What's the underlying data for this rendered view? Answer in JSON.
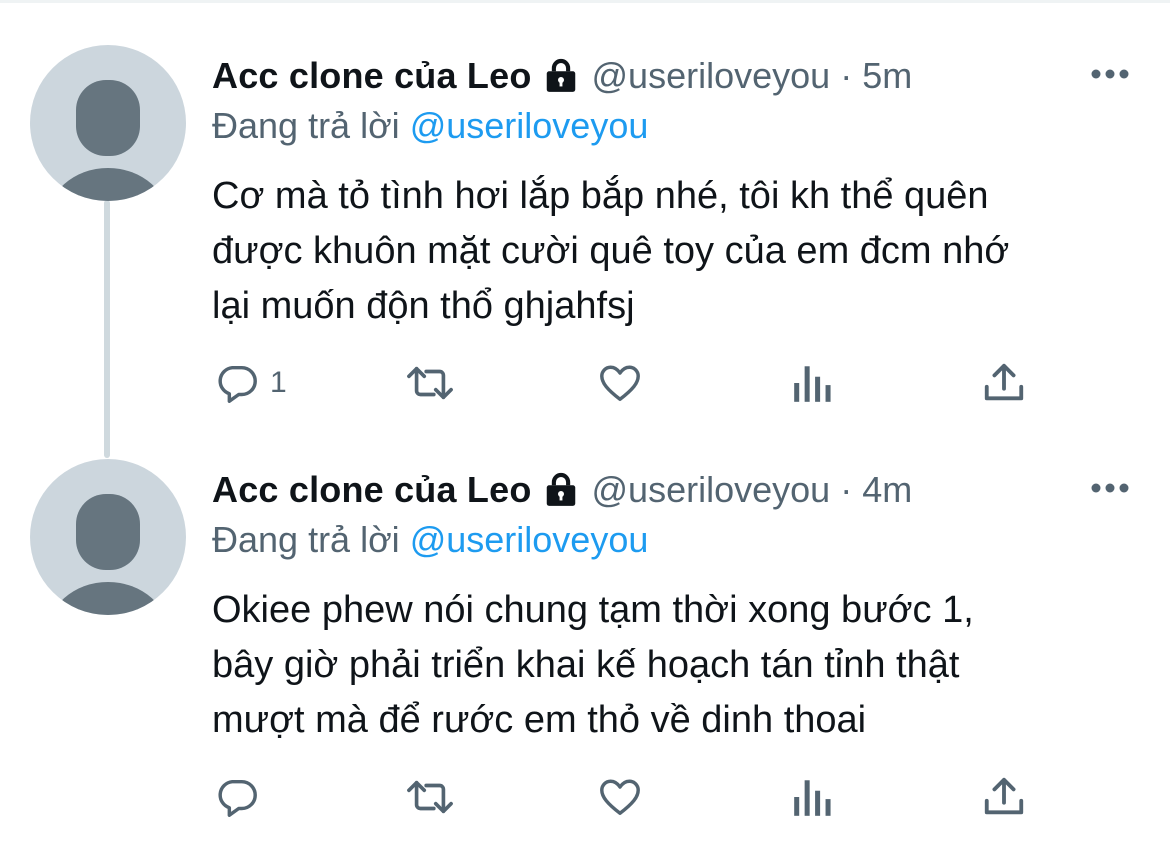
{
  "tweets": [
    {
      "display_name": "Acc clone của Leo",
      "handle": "@useriloveyou",
      "separator": "·",
      "time": "5m",
      "reply_label": "Đang trả lời",
      "reply_to": "@useriloveyou",
      "lines": [
        "Cơ mà tỏ tình hơi lắp bắp nhé, tôi kh thể quên",
        "được khuôn mặt cười quê toy của em đcm nhớ",
        "lại muốn độn thổ ghjahfsj"
      ],
      "reply_count": "1"
    },
    {
      "display_name": "Acc clone của Leo",
      "handle": "@useriloveyou",
      "separator": "·",
      "time": "4m",
      "reply_label": "Đang trả lời",
      "reply_to": "@useriloveyou",
      "lines": [
        "Okiee phew nói chung tạm thời xong bước 1,",
        "bây giờ phải triển khai kế hoạch tán tỉnh thật",
        "mượt mà để rước em thỏ về dinh thoai"
      ],
      "reply_count": ""
    }
  ],
  "icons": {
    "avatar": "default-avatar-icon",
    "protected": "lock-icon",
    "more": "more-horizontal-icon",
    "reply": "reply-icon",
    "retweet": "retweet-icon",
    "like": "heart-icon",
    "analytics": "analytics-icon",
    "share": "share-icon"
  },
  "colors": {
    "link": "#1d9bf0",
    "secondary_text": "#536471",
    "primary_text": "#0f1419",
    "avatar_bg": "#ccd6dd",
    "avatar_fg": "#66757f",
    "thread_line": "#cfd9de"
  }
}
